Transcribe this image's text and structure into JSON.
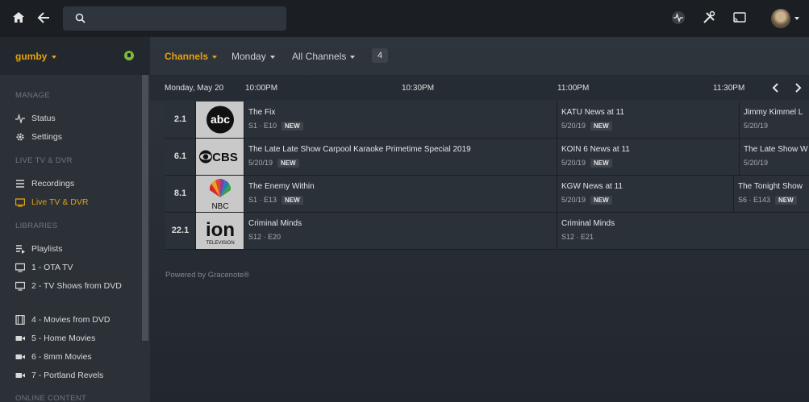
{
  "sidebar": {
    "user": "gumby",
    "sections": {
      "manage": "MANAGE",
      "live": "LIVE TV & DVR",
      "libraries": "LIBRARIES",
      "online": "ONLINE CONTENT"
    },
    "items": [
      {
        "label": "Status",
        "icon": "activity-icon"
      },
      {
        "label": "Settings",
        "icon": "gear-icon"
      },
      {
        "label": "Recordings",
        "icon": "list-icon"
      },
      {
        "label": "Live TV & DVR",
        "icon": "tv-icon"
      },
      {
        "label": "Playlists",
        "icon": "playlist-icon"
      },
      {
        "label": "1 - OTA TV",
        "icon": "monitor-icon"
      },
      {
        "label": "2 - TV Shows from DVD",
        "icon": "monitor-icon"
      },
      {
        "label": "4 - Movies from DVD",
        "icon": "film-icon"
      },
      {
        "label": "5 - Home Movies",
        "icon": "camera-icon"
      },
      {
        "label": "6 - 8mm Movies",
        "icon": "camera-icon"
      },
      {
        "label": "7 - Portland Revels",
        "icon": "camera-icon"
      }
    ]
  },
  "toolbar": {
    "channels": "Channels",
    "day": "Monday",
    "filter": "All Channels",
    "count": "4"
  },
  "timebar": {
    "date": "Monday, May 20",
    "times": [
      "10:00PM",
      "10:30PM",
      "11:00PM",
      "11:30PM"
    ]
  },
  "channels": [
    {
      "number": "2.1",
      "logo": "abc",
      "programs": [
        {
          "title": "The Fix",
          "meta": "S1 · E10",
          "new": "NEW"
        },
        {
          "title": "KATU News at 11",
          "meta": "5/20/19",
          "new": "NEW"
        },
        {
          "title": "Jimmy Kimmel L",
          "meta": "5/20/19",
          "new": ""
        }
      ]
    },
    {
      "number": "6.1",
      "logo": "CBS",
      "programs": [
        {
          "title": "The Late Late Show Carpool Karaoke Primetime Special 2019",
          "meta": "5/20/19",
          "new": "NEW"
        },
        {
          "title": "KOIN 6 News at 11",
          "meta": "5/20/19",
          "new": "NEW"
        },
        {
          "title": "The Late Show W",
          "meta": "5/20/19",
          "new": ""
        }
      ]
    },
    {
      "number": "8.1",
      "logo": "NBC",
      "programs": [
        {
          "title": "The Enemy Within",
          "meta": "S1 · E13",
          "new": "NEW"
        },
        {
          "title": "KGW News at 11",
          "meta": "5/20/19",
          "new": "NEW"
        },
        {
          "title": "The Tonight Show",
          "meta": "S6 · E143",
          "new": "NEW"
        }
      ]
    },
    {
      "number": "22.1",
      "logo": "ion",
      "logo_sub": "TELEVISION",
      "programs": [
        {
          "title": "Criminal Minds",
          "meta": "S12 · E20",
          "new": ""
        },
        {
          "title": "Criminal Minds",
          "meta": "S12 · E21",
          "new": ""
        }
      ]
    }
  ],
  "footer": "Powered by Gracenote®",
  "colors": {
    "accent": "#e5a00d",
    "background": "#242a32"
  }
}
